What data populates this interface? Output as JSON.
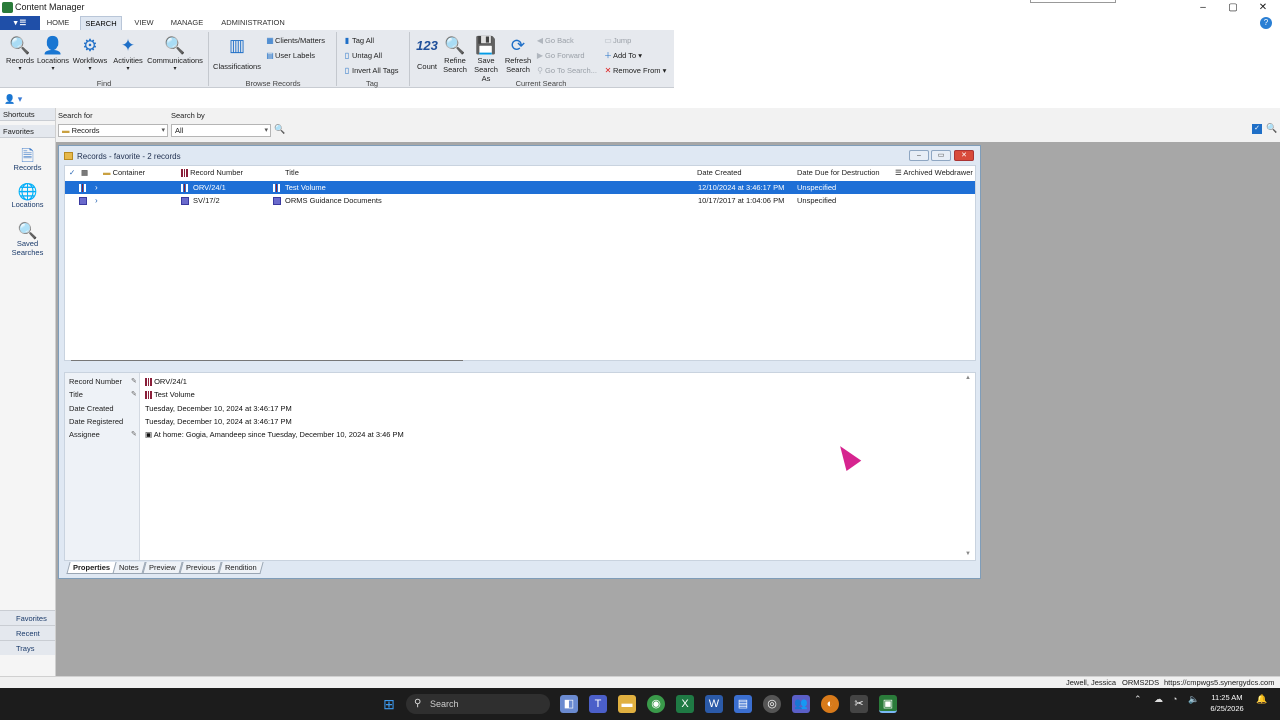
{
  "window": {
    "title": "Content Manager"
  },
  "ribbon_tabs": [
    "HOME",
    "SEARCH",
    "VIEW",
    "MANAGE",
    "ADMINISTRATION"
  ],
  "ribbon": {
    "find_buttons": [
      "Records",
      "Locations",
      "Workflows",
      "Activities",
      "Communications"
    ],
    "find_group": "Find",
    "browse": {
      "classifications": "Classifications",
      "clients_matters": "Clients/Matters",
      "user_labels": "User Labels",
      "group": "Browse Records"
    },
    "tag": {
      "tag_all": "Tag All",
      "untag_all": "Untag All",
      "invert_all_tags": "Invert All Tags",
      "group": "Tag"
    },
    "current_search": {
      "count_glyph": "123",
      "count": "Count",
      "refine_line1": "Refine",
      "refine_line2": "Search",
      "save_line1": "Save",
      "save_line2": "Search As",
      "refresh_line1": "Refresh",
      "refresh_line2": "Search",
      "go_back": "Go Back",
      "go_forward": "Go Forward",
      "go_to_search": "Go To Search...",
      "jump": "Jump",
      "add_to": "Add To",
      "remove_from": "Remove From",
      "group": "Current Search"
    }
  },
  "search": {
    "search_for_label": "Search for",
    "search_for_value": "Records",
    "search_by_label": "Search by",
    "search_by_value": "All"
  },
  "leftnav": {
    "shortcuts": "Shortcuts",
    "favorites_header": "Favorites",
    "items": [
      "Records",
      "Locations",
      "Saved Searches"
    ],
    "bottom": [
      "Favorites",
      "Recent",
      "Trays"
    ]
  },
  "records_window": {
    "title": "Records - favorite - 2 records",
    "columns": [
      "Container",
      "Record Number",
      "Title",
      "Date Created",
      "Date Due for Destruction",
      "Archived Webdrawer"
    ],
    "rows": [
      {
        "record_number": "ORV/24/1",
        "title": "Test Volume",
        "date_created": "12/10/2024 at 3:46:17 PM",
        "destruction": "Unspecified",
        "selected": true
      },
      {
        "record_number": "SV/17/2",
        "title": "ORMS Guidance Documents",
        "date_created": "10/17/2017 at 1:04:06 PM",
        "destruction": "Unspecified",
        "selected": false
      }
    ],
    "properties": [
      {
        "label": "Record Number",
        "value": "ORV/24/1"
      },
      {
        "label": "Title",
        "value": "Test Volume"
      },
      {
        "label": "Date Created",
        "value": "Tuesday, December 10, 2024 at 3:46:17 PM"
      },
      {
        "label": "Date Registered",
        "value": "Tuesday, December 10, 2024 at 3:46:17 PM"
      },
      {
        "label": "Assignee",
        "value": "At home: Gogia, Amandeep since Tuesday, December 10, 2024 at 3:46 PM"
      }
    ],
    "bottom_tabs": [
      "Properties",
      "Notes",
      "Preview",
      "Previous",
      "Rendition"
    ]
  },
  "status_bar": {
    "user": "Jewell, Jessica",
    "dataset": "ORMS2DS",
    "url": "https://cmpwgs5.synergydcs.com"
  },
  "taskbar": {
    "search_placeholder": "Search",
    "time": "11:25 AM",
    "date": "6/25/2026"
  },
  "colors": {
    "selection": "#1e6fd6",
    "accent": "#1f4fa8",
    "cursor": "#d6248f"
  }
}
